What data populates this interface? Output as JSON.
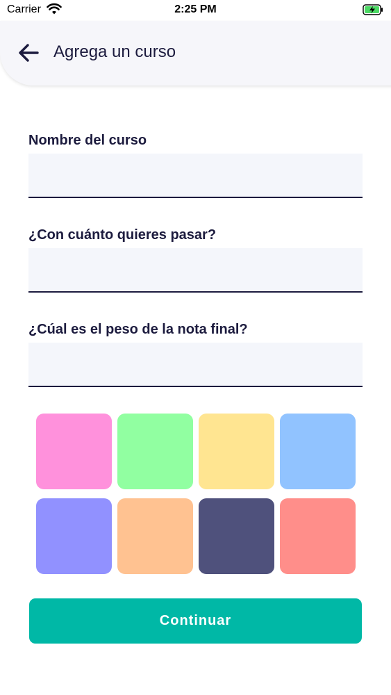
{
  "status_bar": {
    "carrier": "Carrier",
    "time": "2:25 PM",
    "wifi_icon": "wifi-icon",
    "battery_icon": "battery-charging-icon"
  },
  "header": {
    "back_icon": "arrow-left-icon",
    "title": "Agrega un curso"
  },
  "form": {
    "course_name": {
      "label": "Nombre del curso",
      "value": ""
    },
    "pass_grade": {
      "label": "¿Con cuánto quieres pasar?",
      "value": ""
    },
    "final_weight": {
      "label": "¿Cúal es el peso de la nota final?",
      "value": ""
    }
  },
  "color_options": [
    {
      "name": "pink",
      "hex": "#ff91dc"
    },
    {
      "name": "green",
      "hex": "#91ffa1"
    },
    {
      "name": "yellow",
      "hex": "#ffe591"
    },
    {
      "name": "light-blue",
      "hex": "#91c3ff"
    },
    {
      "name": "purple",
      "hex": "#9191ff"
    },
    {
      "name": "orange",
      "hex": "#ffc291"
    },
    {
      "name": "navy",
      "hex": "#4f517c"
    },
    {
      "name": "red",
      "hex": "#ff8e8a"
    }
  ],
  "continue_button": {
    "label": "Continuar"
  },
  "colors": {
    "accent": "#00b8a6",
    "text": "#1c1b3e",
    "input_bg": "#f4f6fb",
    "header_bg": "#f6f6fa"
  }
}
